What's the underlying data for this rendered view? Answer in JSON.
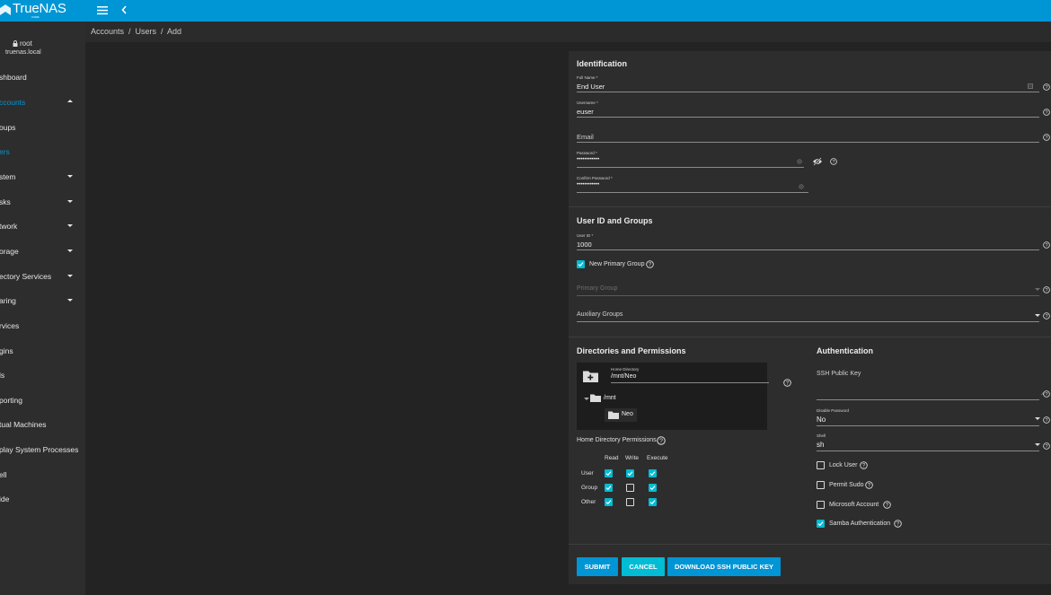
{
  "app": {
    "logo_text": "TrueNAS",
    "logo_sub": "CORE"
  },
  "breadcrumb": "Accounts  /  Users  /  Add",
  "user": {
    "name": "root",
    "host": "truenas.local"
  },
  "nav": [
    {
      "label": "shboard"
    },
    {
      "label": "ccounts",
      "expanded": true
    },
    {
      "label": "oups"
    },
    {
      "label": "ers"
    },
    {
      "label": "stem",
      "expandable": true
    },
    {
      "label": "sks",
      "expandable": true
    },
    {
      "label": "twork",
      "expandable": true
    },
    {
      "label": "orage",
      "expandable": true
    },
    {
      "label": "ectory Services",
      "expandable": true
    },
    {
      "label": "aring",
      "expandable": true
    },
    {
      "label": "rvices"
    },
    {
      "label": "gins"
    },
    {
      "label": "ls"
    },
    {
      "label": "porting"
    },
    {
      "label": "tual Machines"
    },
    {
      "label": "play System Processes"
    },
    {
      "label": "ell"
    },
    {
      "label": "ide"
    }
  ],
  "form": {
    "identification": {
      "title": "Identification",
      "full_name_label": "Full Name *",
      "full_name_value": "End User",
      "username_label": "Username *",
      "username_value": "euser",
      "email_placeholder": "Email",
      "password_label": "Password *",
      "password_value": "••••••••••••",
      "confirm_label": "Confirm Password *",
      "confirm_value": "••••••••••••"
    },
    "groups": {
      "title": "User ID and Groups",
      "uid_label": "User ID *",
      "uid_value": "1000",
      "new_primary_group_label": "New Primary Group",
      "new_primary_group_checked": true,
      "primary_group_placeholder": "Primary Group",
      "aux_groups_placeholder": "Auxiliary Groups"
    },
    "directories": {
      "title": "Directories and Permissions",
      "home_dir_label": "Home Directory",
      "home_dir_value": "/mnt/Neo",
      "tree_root": "/mnt",
      "tree_child": "Neo",
      "perms_label": "Home Directory Permissions",
      "perm_cols": [
        "Read",
        "Write",
        "Execute"
      ],
      "perm_rows": [
        {
          "label": "User",
          "values": [
            true,
            true,
            true
          ]
        },
        {
          "label": "Group",
          "values": [
            true,
            false,
            true
          ]
        },
        {
          "label": "Other",
          "values": [
            true,
            false,
            true
          ]
        }
      ]
    },
    "authentication": {
      "title": "Authentication",
      "ssh_key_placeholder": "SSH Public Key",
      "disable_password_label": "Disable Password",
      "disable_password_value": "No",
      "shell_label": "Shell",
      "shell_value": "sh",
      "lock_user_label": "Lock User",
      "lock_user_checked": false,
      "permit_sudo_label": "Permit Sudo",
      "permit_sudo_checked": false,
      "microsoft_account_label": "Microsoft Account",
      "microsoft_account_checked": false,
      "samba_label": "Samba Authentication",
      "samba_checked": true
    },
    "actions": {
      "submit": "SUBMIT",
      "cancel": "CANCEL",
      "download": "DOWNLOAD SSH PUBLIC KEY"
    }
  },
  "colors": {
    "accent": "#0095d5",
    "checkbox": "#00bcd4",
    "background": "#232323",
    "card": "#2d2d2d"
  }
}
